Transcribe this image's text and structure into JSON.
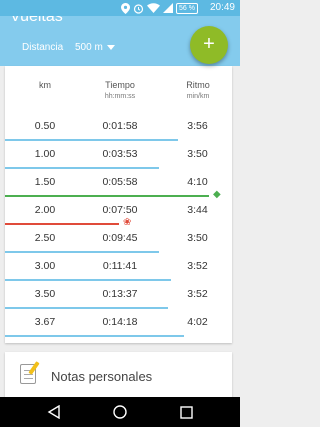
{
  "status_bar": {
    "time": "20:49",
    "battery": "56 %",
    "icons": [
      "location-icon",
      "alarm-icon",
      "wifi-icon",
      "signal-icon",
      "battery-icon"
    ]
  },
  "app_bar": {
    "title": "Vueltas",
    "distance_label": "Distancia",
    "distance_value": "500 m",
    "add_button_label": "+"
  },
  "table": {
    "headers": {
      "km": "km",
      "tiempo": "Tiempo",
      "tiempo_unit": "hh:mm:ss",
      "ritmo": "Ritmo",
      "ritmo_unit": "min/km"
    },
    "rows": [
      {
        "km": "0.50",
        "time": "0:01:58",
        "pace": "3:56",
        "state": "normal",
        "bar_fraction": 0.76
      },
      {
        "km": "1.00",
        "time": "0:03:53",
        "pace": "3:50",
        "state": "normal",
        "bar_fraction": 0.68
      },
      {
        "km": "1.50",
        "time": "0:05:58",
        "pace": "4:10",
        "state": "slowest",
        "bar_fraction": 0.9
      },
      {
        "km": "2.00",
        "time": "0:07:50",
        "pace": "3:44",
        "state": "fastest",
        "bar_fraction": 0.5
      },
      {
        "km": "2.50",
        "time": "0:09:45",
        "pace": "3:50",
        "state": "normal",
        "bar_fraction": 0.68
      },
      {
        "km": "3.00",
        "time": "0:11:41",
        "pace": "3:52",
        "state": "normal",
        "bar_fraction": 0.73
      },
      {
        "km": "3.50",
        "time": "0:13:37",
        "pace": "3:52",
        "state": "normal",
        "bar_fraction": 0.72
      },
      {
        "km": "3.67",
        "time": "0:14:18",
        "pace": "4:02",
        "state": "normal",
        "bar_fraction": 0.79
      }
    ]
  },
  "notes": {
    "label": "Notas personales"
  },
  "colors": {
    "accent": "#84cbed",
    "fab": "#8fbb27",
    "normal_bar": "#7ec8ea",
    "slowest_bar": "#4caf50",
    "fastest_bar": "#e04b3a"
  }
}
